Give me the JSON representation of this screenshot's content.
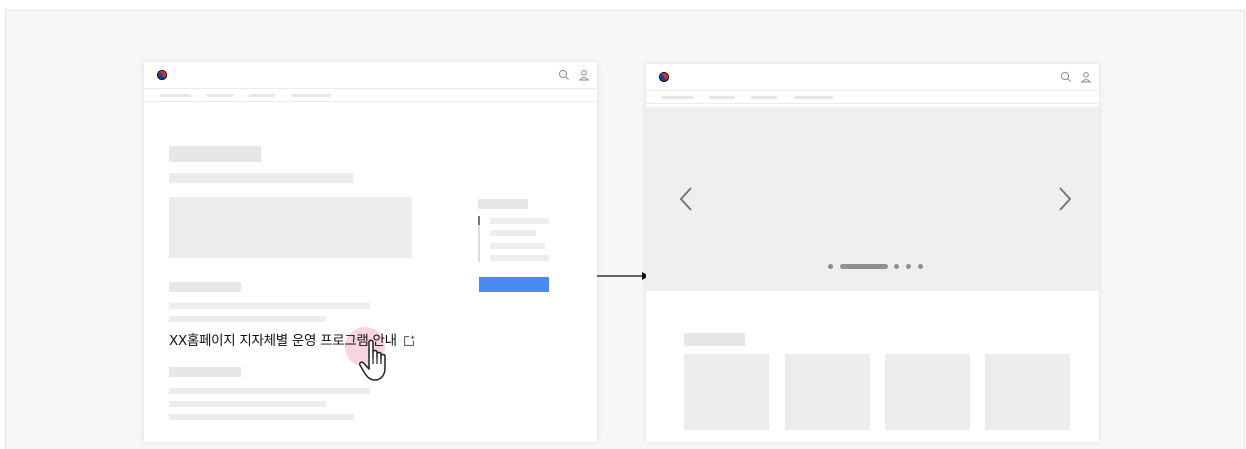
{
  "link": {
    "text": "XX홈페이지 지자체별 운영 프로그램 안내"
  },
  "icons": {
    "logo": "taegeuk-logo-icon",
    "search": "search-icon",
    "user": "user-icon",
    "external_link": "external-link-icon",
    "cursor": "hand-pointer-cursor-icon",
    "prev": "chevron-left-icon",
    "next": "chevron-right-icon",
    "flow": "arrow-right-icon"
  },
  "carousel": {
    "slides": 5,
    "active_index": 0
  },
  "colors": {
    "accent_button": "#4a8af4",
    "skeleton": "#e7e7e7",
    "click_highlight": "#f6c6d6",
    "logo_red": "#cd2e3a",
    "logo_blue": "#0047a0"
  }
}
